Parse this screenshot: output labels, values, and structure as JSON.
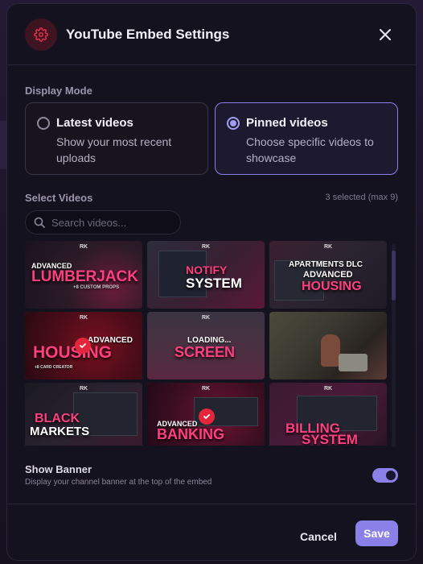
{
  "modal": {
    "title": "YouTube Embed Settings",
    "close_icon": "close-icon",
    "header_icon": "gear-icon"
  },
  "display_mode": {
    "label": "Display Mode",
    "options": [
      {
        "title": "Latest videos",
        "description": "Show your most recent uploads",
        "selected": false
      },
      {
        "title": "Pinned videos",
        "description": "Choose specific videos to showcase",
        "selected": true
      }
    ]
  },
  "select_videos": {
    "label": "Select Videos",
    "count": "3 selected (max 9)",
    "search_placeholder": "Search videos...",
    "videos": [
      {
        "line1": "ADVANCED",
        "line2": "LUMBERJACK",
        "line3": "+8 CUSTOM PROPS",
        "selected": false
      },
      {
        "line1": "NOTIFY",
        "line2": "SYSTEM",
        "selected": false
      },
      {
        "line1": "APARTMENTS DLC",
        "line2": "ADVANCED",
        "line3": "HOUSING",
        "selected": false
      },
      {
        "line1": "ADVANCED",
        "line2": "HOUSING",
        "line3": "+8 CARD CREATOR",
        "selected": true
      },
      {
        "line1": "LOADING...",
        "line2": "SCREEN",
        "selected": false
      },
      {
        "line1": "",
        "line2": "",
        "selected": false
      },
      {
        "line1": "BLACK",
        "line2": "MARKETS",
        "selected": false
      },
      {
        "line1": "ADVANCED",
        "line2": "BANKING",
        "selected": true
      },
      {
        "line1": "BILLING",
        "line2": "SYSTEM",
        "selected": false
      }
    ],
    "logo_text": "RK"
  },
  "banner": {
    "title": "Show Banner",
    "description": "Display your channel banner at the top of the embed",
    "enabled": true
  },
  "footer": {
    "cancel_label": "Cancel",
    "save_label": "Save"
  },
  "colors": {
    "accent": "#8a80e8",
    "selected_border": "#e02a3a",
    "brand_pink": "#ff3f7e"
  }
}
